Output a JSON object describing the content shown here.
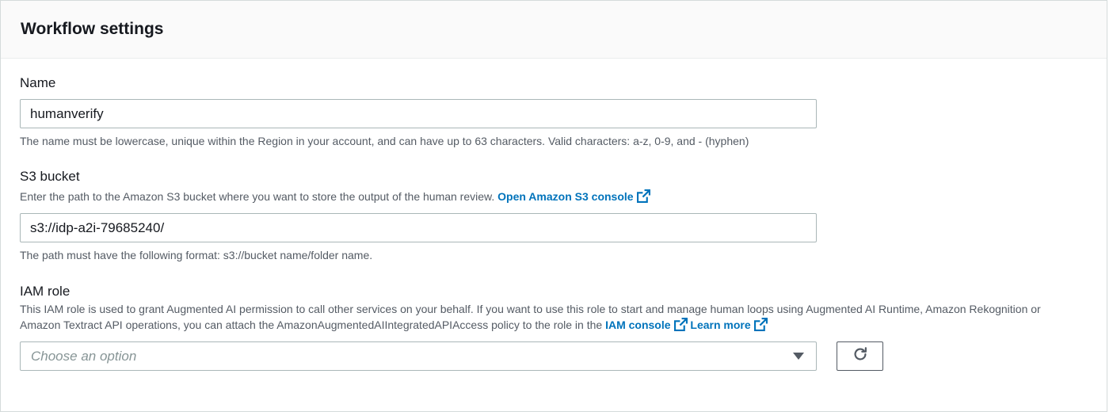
{
  "section": {
    "title": "Workflow settings"
  },
  "name_field": {
    "label": "Name",
    "value": "humanverify",
    "constraint": "The name must be lowercase, unique within the Region in your account, and can have up to 63 characters. Valid characters: a-z, 0-9, and - (hyphen)"
  },
  "s3_field": {
    "label": "S3 bucket",
    "description": "Enter the path to the Amazon S3 bucket where you want to store the output of the human review.",
    "console_link": "Open Amazon S3 console",
    "value": "s3://idp-a2i-79685240/",
    "constraint": "The path must have the following format: s3://bucket name/folder name."
  },
  "iam_field": {
    "label": "IAM role",
    "description": "This IAM role is used to grant Augmented AI permission to call other services on your behalf. If you want to use this role to start and manage human loops using Augmented AI Runtime, Amazon Rekognition or Amazon Textract API operations, you can attach the AmazonAugmentedAIIntegratedAPIAccess policy to the role in the",
    "console_link": "IAM console",
    "learn_more_link": "Learn more",
    "placeholder": "Choose an option"
  },
  "icons": {
    "external_link": "external-link-icon",
    "dropdown": "caret-down-icon",
    "refresh": "refresh-icon"
  },
  "colors": {
    "link": "#0073bb",
    "header_bg": "#fafafa",
    "border": "#aab7b8",
    "muted_text": "#545b64"
  }
}
